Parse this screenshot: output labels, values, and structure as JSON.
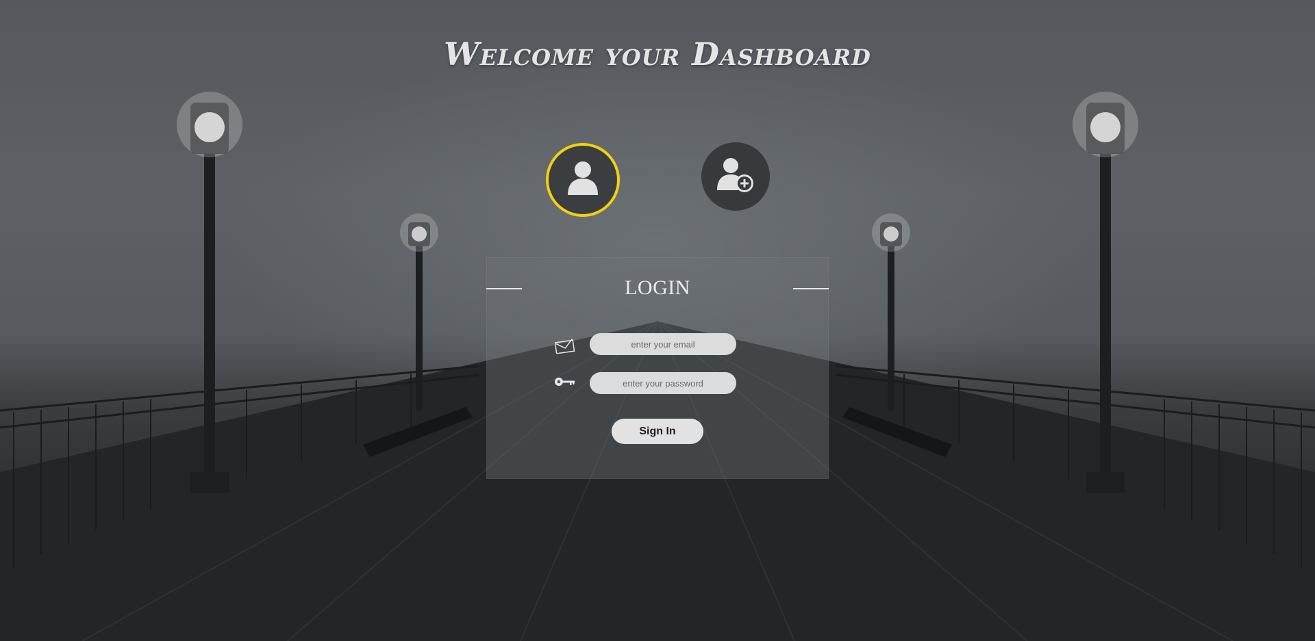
{
  "page": {
    "title": "Welcome your Dashboard"
  },
  "tabs": [
    {
      "icon": "user-icon",
      "active": true
    },
    {
      "icon": "user-plus-icon",
      "active": false
    }
  ],
  "login": {
    "heading": "LOGIN",
    "email_icon": "envelope-icon",
    "email_placeholder": "enter your email",
    "password_icon": "key-icon",
    "password_placeholder": "enter your password",
    "submit_label": "Sign In"
  },
  "colors": {
    "active_ring": "#f4d012",
    "circle_bg": "#3a3d40",
    "input_bg": "#dcdcdc",
    "button_bg": "#e2e2e2"
  }
}
